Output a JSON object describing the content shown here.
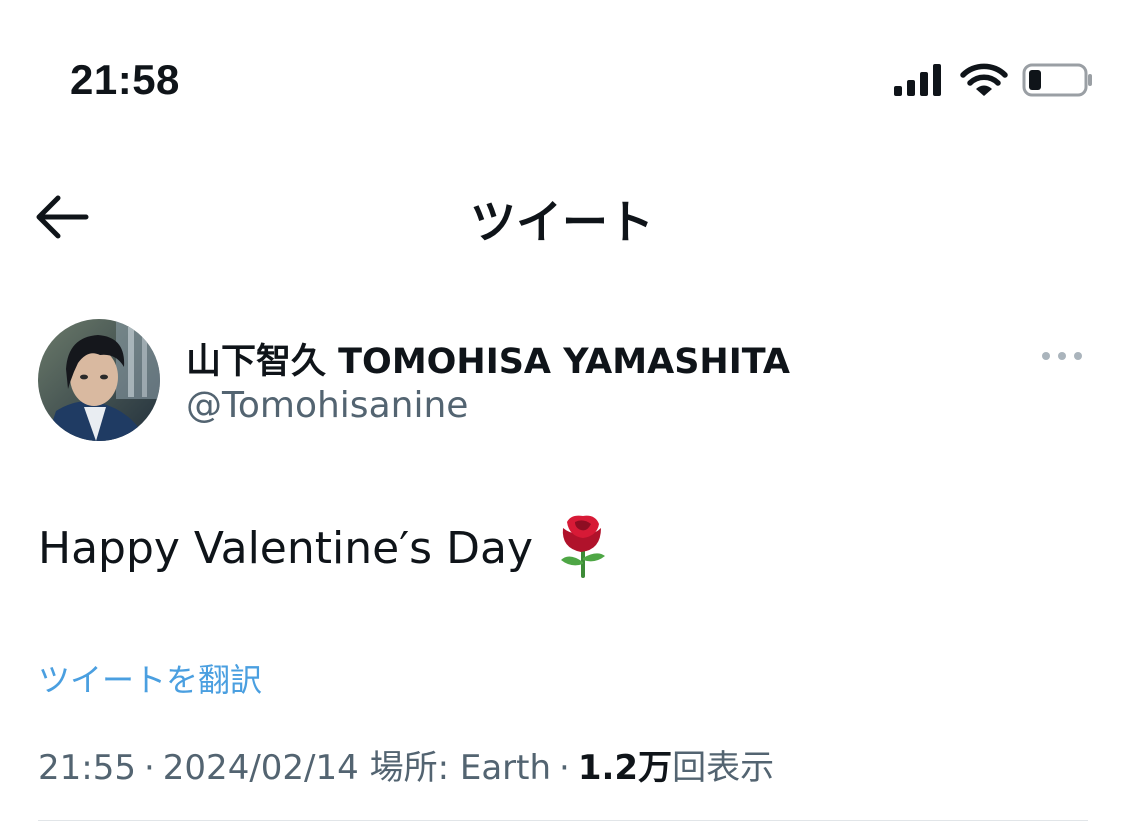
{
  "status_bar": {
    "time": "21:58",
    "icons": [
      "cellular-signal-icon",
      "wifi-icon",
      "battery-low-icon"
    ]
  },
  "nav": {
    "back_icon": "arrow-left-icon",
    "title": "ツイート"
  },
  "author": {
    "display_name": "山下智久 TOMOHISA YAMASHITA",
    "handle": "@Tomohisanine",
    "avatar": "avatar-photo",
    "more_icon": "more-horizontal-icon"
  },
  "tweet": {
    "text": "Happy Valentine′s Day",
    "emoji": "rose-icon",
    "translate_label": "ツイートを翻訳"
  },
  "meta": {
    "time": "21:55",
    "separator": "·",
    "date": "2024/02/14",
    "location_label": "場所: Earth",
    "views_count": "1.2万",
    "views_label": "回表示"
  },
  "colors": {
    "text_primary": "#0f1419",
    "text_secondary": "#536471",
    "link": "#4a9fe0",
    "divider": "#e1e5e8",
    "rose_red": "#c8102e"
  }
}
